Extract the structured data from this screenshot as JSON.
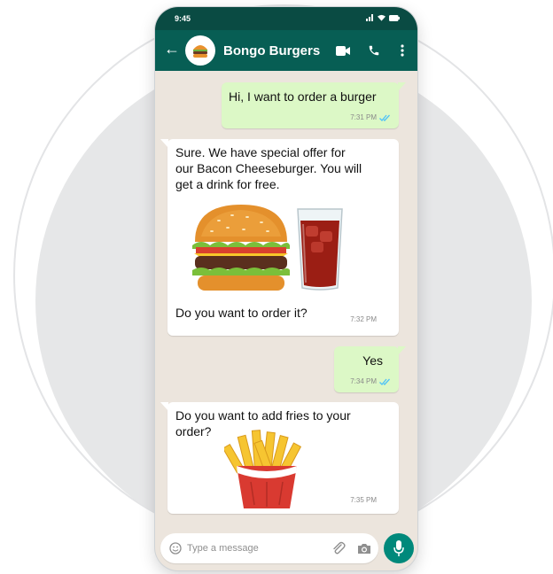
{
  "status_bar": {
    "time": "9:45"
  },
  "header": {
    "contact_name": "Bongo Burgers"
  },
  "messages": [
    {
      "direction": "out",
      "text": "Hi, I want to order a burger",
      "time": "7:31 PM"
    },
    {
      "direction": "in",
      "text_lines": [
        "Sure. We have special offer for",
        "our Bacon Cheeseburger. You will",
        "get a drink for free."
      ],
      "image": "burger-and-soda",
      "text2": "Do you want to order it?",
      "time": "7:32 PM"
    },
    {
      "direction": "out",
      "text": "Yes",
      "time": "7:34 PM"
    },
    {
      "direction": "in",
      "text_lines": [
        "Do you want to add fries to your",
        "order?"
      ],
      "image": "fries",
      "time": "7:35 PM"
    }
  ],
  "composer": {
    "placeholder": "Type a message"
  },
  "colors": {
    "header": "#075e54",
    "status_bar": "#0a4b43",
    "outgoing": "#dcf8c6",
    "incoming": "#ffffff",
    "chat_bg": "#ece5dd",
    "mic_button": "#00897b",
    "read_ticks": "#4fc3f7"
  }
}
